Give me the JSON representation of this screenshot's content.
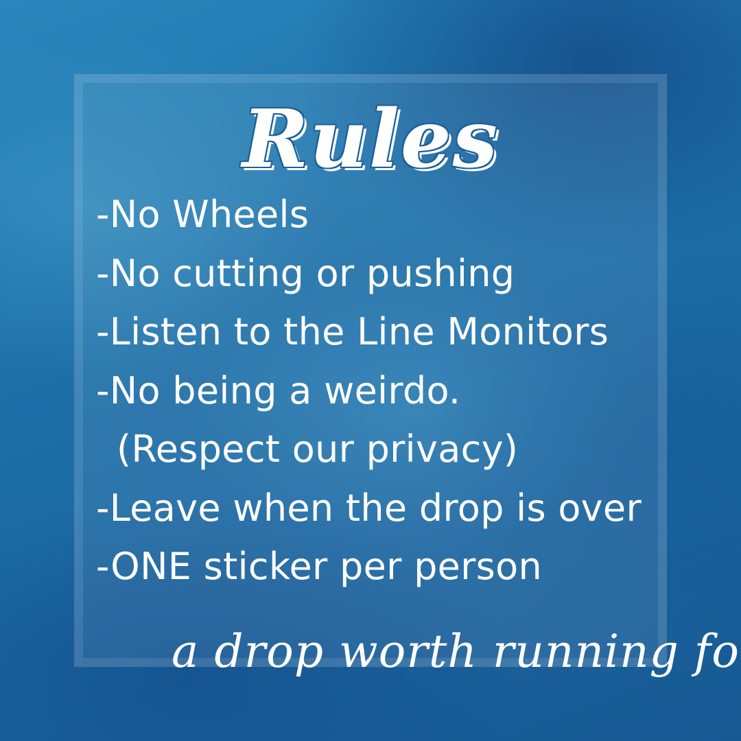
{
  "title": "Rules",
  "rules": [
    "-No Wheels",
    "-No cutting or pushing",
    "-Listen to the Line Monitors",
    "-No being a weirdo.",
    "(Respect our privacy)",
    "-Leave when the drop is over",
    "-ONE sticker per person"
  ],
  "tagline": "a drop worth running for",
  "colors": {
    "background": "#1f6fa6",
    "text": "#ffffff",
    "title_outline": "#1c5f96"
  }
}
